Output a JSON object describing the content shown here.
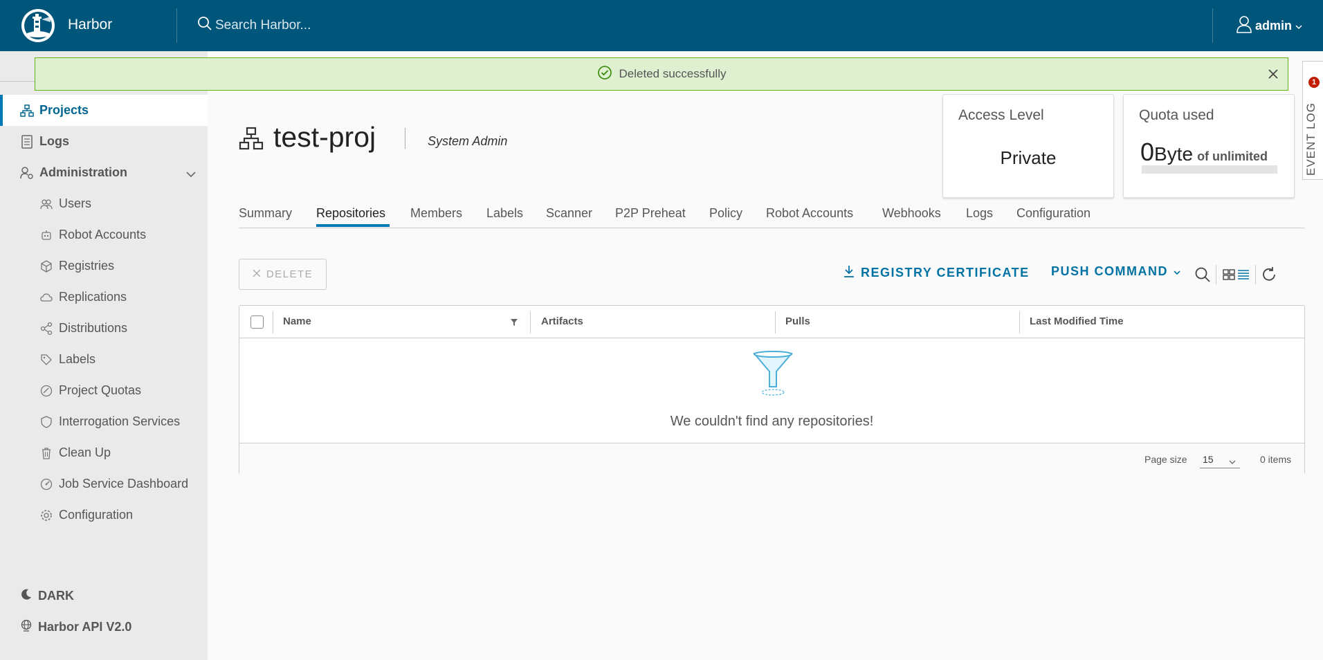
{
  "header": {
    "brand": "Harbor",
    "search_placeholder": "Search Harbor...",
    "user": "admin"
  },
  "alert": {
    "message": "Deleted successfully"
  },
  "sidebar": {
    "items": [
      {
        "label": "Projects",
        "icon": "projects-icon"
      },
      {
        "label": "Logs",
        "icon": "logs-icon"
      },
      {
        "label": "Administration",
        "icon": "administration-icon"
      }
    ],
    "admin_items": [
      {
        "label": "Users",
        "icon": "users-icon"
      },
      {
        "label": "Robot Accounts",
        "icon": "robot-icon"
      },
      {
        "label": "Registries",
        "icon": "registries-icon"
      },
      {
        "label": "Replications",
        "icon": "replications-icon"
      },
      {
        "label": "Distributions",
        "icon": "distributions-icon"
      },
      {
        "label": "Labels",
        "icon": "labels-icon"
      },
      {
        "label": "Project Quotas",
        "icon": "quotas-icon"
      },
      {
        "label": "Interrogation Services",
        "icon": "shield-icon"
      },
      {
        "label": "Clean Up",
        "icon": "trash-icon"
      },
      {
        "label": "Job Service Dashboard",
        "icon": "dashboard-icon"
      },
      {
        "label": "Configuration",
        "icon": "gear-icon"
      }
    ],
    "dark_label": "DARK",
    "api_label": "Harbor API V2.0"
  },
  "event_log": {
    "label": "EVENT LOG",
    "badge": "1"
  },
  "project": {
    "name": "test-proj",
    "role": "System Admin"
  },
  "cards": {
    "access": {
      "title": "Access Level",
      "value": "Private"
    },
    "quota": {
      "title": "Quota used",
      "number": "0",
      "unit": "Byte",
      "of_text": "of unlimited",
      "used_fraction": 0
    }
  },
  "tabs": [
    "Summary",
    "Repositories",
    "Members",
    "Labels",
    "Scanner",
    "P2P Preheat",
    "Policy",
    "Robot Accounts",
    "Webhooks",
    "Logs",
    "Configuration"
  ],
  "active_tab": "Repositories",
  "toolbar": {
    "delete_label": "DELETE",
    "registry_cert_label": "REGISTRY CERTIFICATE",
    "push_command_label": "PUSH COMMAND"
  },
  "table": {
    "columns": [
      "Name",
      "Artifacts",
      "Pulls",
      "Last Modified Time"
    ],
    "empty_message": "We couldn't find any repositories!",
    "page_size_label": "Page size",
    "page_size": "15",
    "items_count": "0 items"
  },
  "colors": {
    "header_bg": "#00567a",
    "accent": "#0079b8",
    "link": "#0072a3",
    "alert_bg": "#dff0d0",
    "alert_border": "#60b515",
    "badge": "#c21d00"
  }
}
